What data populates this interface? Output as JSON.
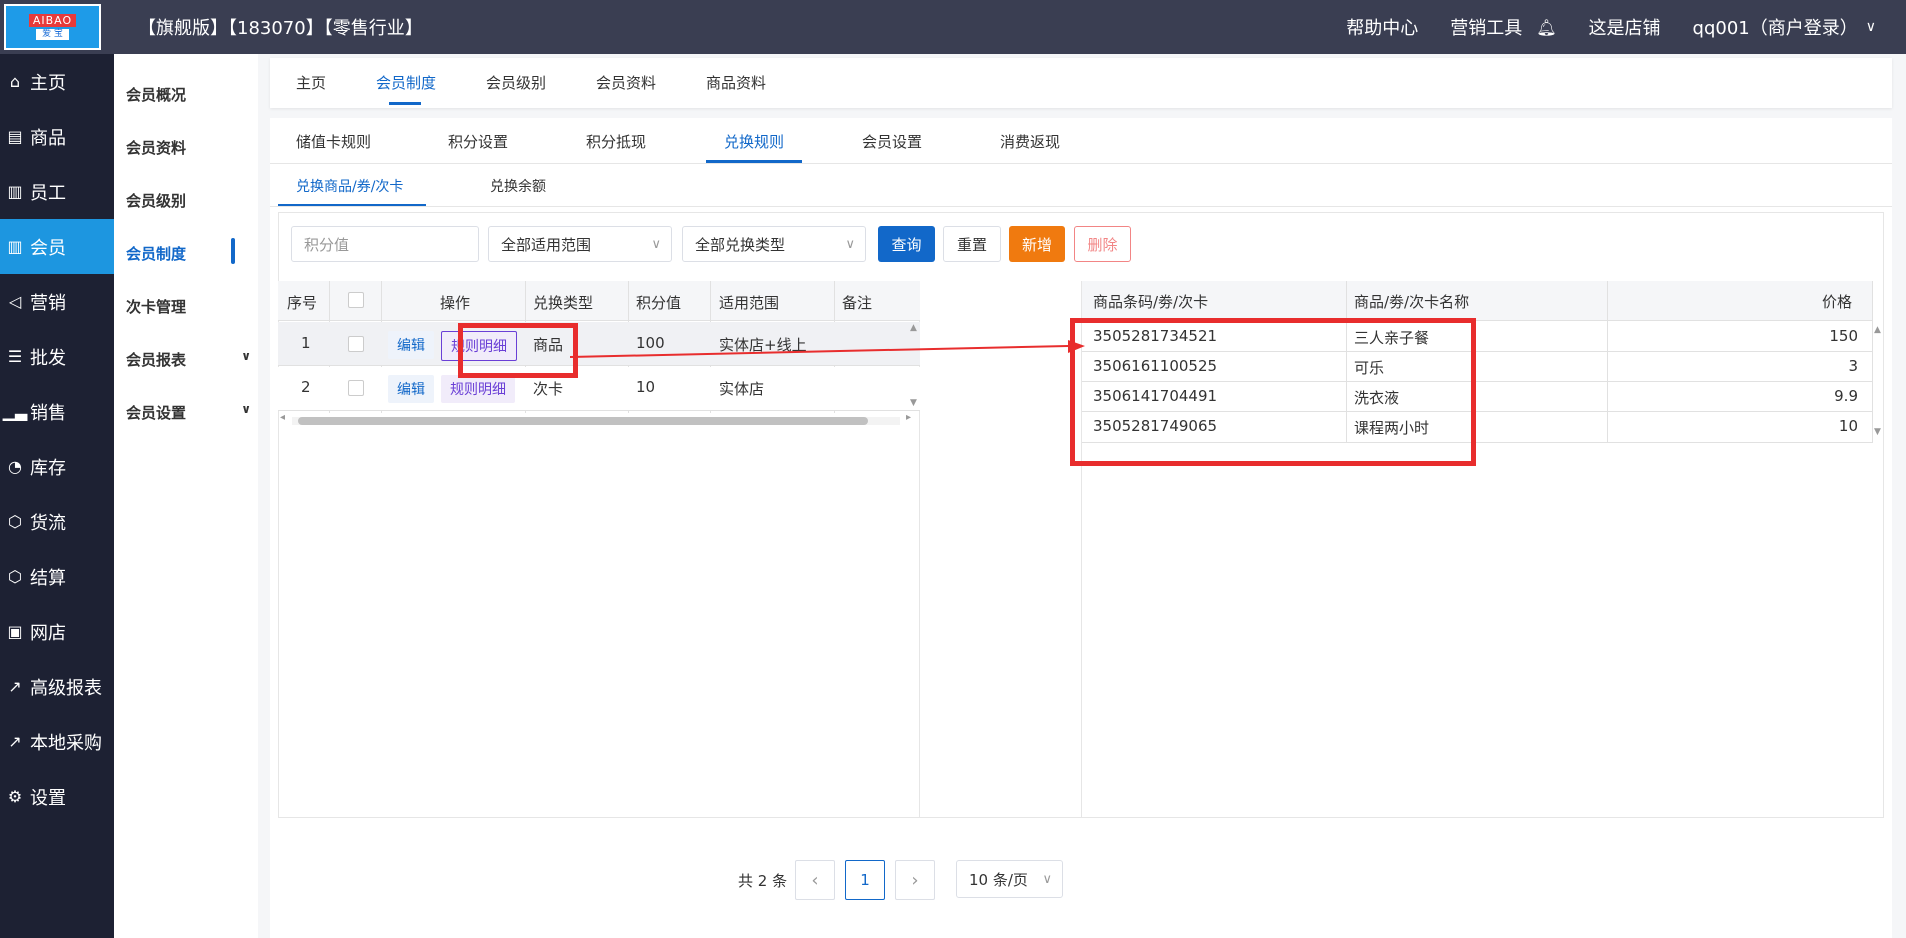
{
  "topbar": {
    "logo_top": "AIBAO",
    "logo_bottom": "爱 宝",
    "title": "【旗舰版】【183070】【零售行业】",
    "nav": [
      "帮助中心",
      "营销工具",
      "这是店铺",
      "qq001（商户登录）"
    ]
  },
  "sidebar": {
    "items": [
      {
        "label": "主页",
        "icon": "home-icon"
      },
      {
        "label": "商品",
        "icon": "box-icon"
      },
      {
        "label": "员工",
        "icon": "staff-icon"
      },
      {
        "label": "会员",
        "icon": "member-icon"
      },
      {
        "label": "营销",
        "icon": "megaphone-icon"
      },
      {
        "label": "批发",
        "icon": "list-icon"
      },
      {
        "label": "销售",
        "icon": "chart-icon"
      },
      {
        "label": "库存",
        "icon": "pie-icon"
      },
      {
        "label": "货流",
        "icon": "flow-icon"
      },
      {
        "label": "结算",
        "icon": "settle-icon"
      },
      {
        "label": "网店",
        "icon": "gift-icon"
      },
      {
        "label": "高级报表",
        "icon": "line-chart-icon"
      },
      {
        "label": "本地采购",
        "icon": "trend-icon"
      },
      {
        "label": "设置",
        "icon": "gear-icon"
      }
    ],
    "active_index": 3
  },
  "submenu": {
    "items": [
      "会员概况",
      "会员资料",
      "会员级别",
      "会员制度",
      "次卡管理",
      "会员报表",
      "会员设置"
    ]
  },
  "tabs_top": [
    "主页",
    "会员制度",
    "会员级别",
    "会员资料",
    "商品资料"
  ],
  "tabs_second": [
    "储值卡规则",
    "积分设置",
    "积分抵现",
    "兑换规则",
    "会员设置",
    "消费返现"
  ],
  "tabs_third": [
    "兑换商品/券/次卡",
    "兑换余额"
  ],
  "filters": {
    "points_placeholder": "积分值",
    "scope_selected": "全部适用范围",
    "type_selected": "全部兑换类型"
  },
  "buttons": {
    "query": "查询",
    "reset": "重置",
    "add": "新增",
    "delete": "删除"
  },
  "left_table": {
    "headers": [
      "序号",
      "",
      "操作",
      "兑换类型",
      "积分值",
      "适用范围",
      "备注"
    ],
    "rows": [
      {
        "index": "1",
        "edit": "编辑",
        "rule": "规则明细",
        "type": "商品",
        "points": "100",
        "scope": "实体店+线上",
        "note": ""
      },
      {
        "index": "2",
        "edit": "编辑",
        "rule": "规则明细",
        "type": "次卡",
        "points": "10",
        "scope": "实体店",
        "note": ""
      }
    ]
  },
  "right_table": {
    "headers": [
      "商品条码/劵/次卡",
      "商品/劵/次卡名称",
      "价格"
    ],
    "rows": [
      {
        "code": "3505281734521",
        "name": "三人亲子餐",
        "price": "150"
      },
      {
        "code": "3506161100525",
        "name": "可乐",
        "price": "3"
      },
      {
        "code": "3506141704491",
        "name": "洗衣液",
        "price": "9.9"
      },
      {
        "code": "3505281749065",
        "name": "课程两小时",
        "price": "10"
      }
    ]
  },
  "pagination": {
    "total": "共 2 条",
    "current": "1",
    "page_size": "10 条/页"
  },
  "colors": {
    "accent": "#1268c9",
    "sidebar_bg": "#1d2133",
    "topbar_bg": "#3a3e52",
    "highlight": "#e82d2d",
    "add_button": "#f07a0f"
  }
}
